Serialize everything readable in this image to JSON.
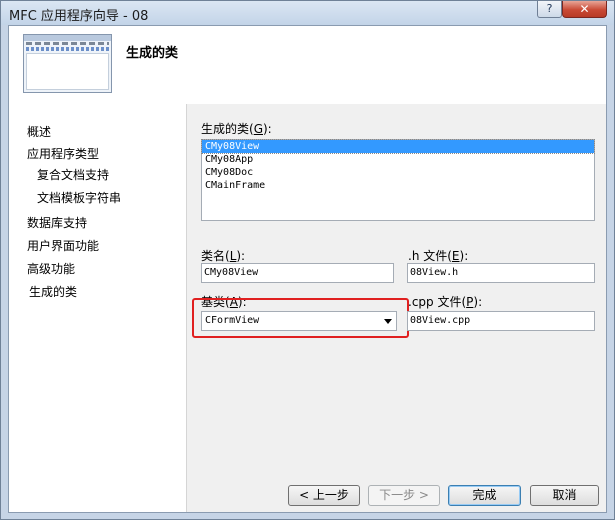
{
  "window": {
    "title": "MFC 应用程序向导 - 08",
    "help_glyph": "?",
    "close_glyph": "✕"
  },
  "header": {
    "title": "生成的类"
  },
  "nav": {
    "items": [
      {
        "label": "概述"
      },
      {
        "label": "应用程序类型"
      },
      {
        "label": "复合文档支持"
      },
      {
        "label": "文档模板字符串"
      },
      {
        "label": "数据库支持"
      },
      {
        "label": "用户界面功能"
      },
      {
        "label": "高级功能"
      },
      {
        "label": "生成的类"
      }
    ]
  },
  "form": {
    "classes_label_pre": "生成的类(",
    "classes_label_key": "G",
    "classes_label_post": "):",
    "classes": [
      "CMy08View",
      "CMy08App",
      "CMy08Doc",
      "CMainFrame"
    ],
    "selected_class": "CMy08View",
    "class_name_label_pre": "类名(",
    "class_name_label_key": "L",
    "class_name_label_post": "):",
    "class_name_value": "CMy08View",
    "h_file_label_pre": ".h 文件(",
    "h_file_label_key": "E",
    "h_file_label_post": "):",
    "h_file_value": "08View.h",
    "base_class_label_pre": "基类(",
    "base_class_label_key": "A",
    "base_class_label_post": "):",
    "base_class_value": "CFormView",
    "cpp_file_label_pre": ".cpp 文件(",
    "cpp_file_label_key": "P",
    "cpp_file_label_post": "):",
    "cpp_file_value": "08View.cpp"
  },
  "buttons": {
    "back": "< 上一步",
    "next": "下一步 >",
    "finish": "完成",
    "cancel": "取消"
  },
  "colors": {
    "selection": "#3399ff",
    "annotation_box": "#e02020",
    "panel_bg": "#f0f0f0"
  }
}
